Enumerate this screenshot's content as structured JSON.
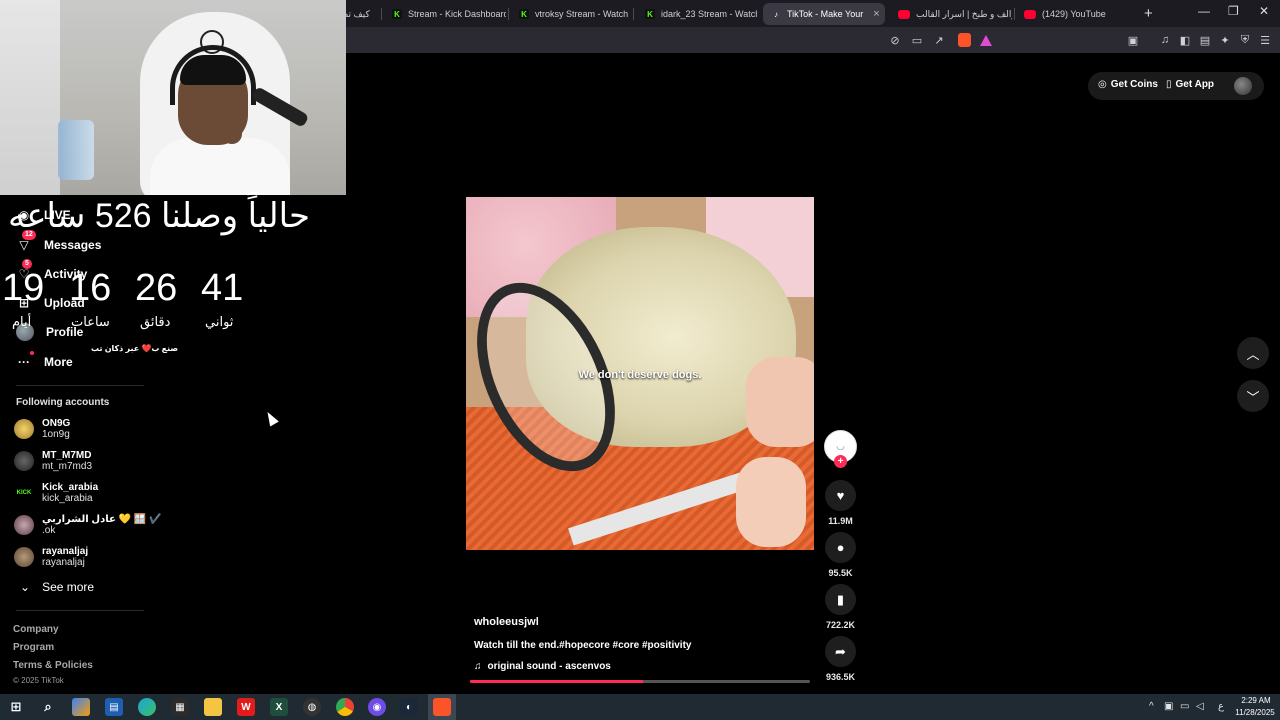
{
  "browser": {
    "tabs": [
      {
        "title": "كيف تصـ",
        "icon": "generic",
        "active": false
      },
      {
        "title": "Stream - Kick Dashboard",
        "icon": "kick-icon",
        "active": false
      },
      {
        "title": "vtroksy Stream - Watch Li",
        "icon": "kick-icon",
        "active": false
      },
      {
        "title": "idark_23 Stream - Watch L",
        "icon": "kick-icon",
        "active": false
      },
      {
        "title": "TikTok - Make Your",
        "icon": "tiktok-icon",
        "active": true
      },
      {
        "title": "سوالف و طبخ | اسرار القالب",
        "icon": "youtube-icon",
        "active": false
      },
      {
        "title": "(1429) YouTube",
        "icon": "youtube-icon",
        "active": false
      }
    ],
    "new_tab": "+",
    "window_controls": {
      "minimize": "—",
      "restore": "❐",
      "close": "✕"
    },
    "close_tab": "×"
  },
  "overlay": {
    "title": "حالياً وصلنا 526 ساعه",
    "countdown": [
      {
        "value": "19",
        "label": "أيام"
      },
      {
        "value": "16",
        "label": "ساعات"
      },
      {
        "value": "26",
        "label": "دقائق"
      },
      {
        "value": "41",
        "label": "ثواني"
      }
    ],
    "credit": "صنع ب❤️ عبر ذكان تب"
  },
  "sidebar": {
    "nav": [
      {
        "label": "LIVE",
        "icon": "live-icon",
        "badge": ""
      },
      {
        "label": "Messages",
        "icon": "messages-icon",
        "badge": "12"
      },
      {
        "label": "Activity",
        "icon": "activity-icon",
        "badge": "5"
      },
      {
        "label": "Upload",
        "icon": "upload-icon",
        "badge": ""
      },
      {
        "label": "Profile",
        "icon": "profile-avatar",
        "badge": ""
      },
      {
        "label": "More",
        "icon": "more-icon",
        "badge": ""
      }
    ],
    "following_title": "Following accounts",
    "accounts": [
      {
        "name": "ON9G",
        "handle": "1on9g"
      },
      {
        "name": "MT_M7MD",
        "handle": "mt_m7md3"
      },
      {
        "name": "Kick_arabia",
        "handle": "kick_arabia"
      },
      {
        "name": "عادل الشراربي 💛 🪟 ✔️",
        "handle": ".ok"
      },
      {
        "name": "rayanaljaj",
        "handle": "rayanaljaj"
      }
    ],
    "see_more": "See more",
    "footer": [
      "Company",
      "Program",
      "Terms & Policies"
    ],
    "copyright": "© 2025 TikTok"
  },
  "header": {
    "get_coins": "Get Coins",
    "get_app": "Get App"
  },
  "video": {
    "caption": "We don't deserve dogs.",
    "author": "wholeeusjwl",
    "description": "Watch till the end.#hopecore #core #positivity",
    "sound": "original sound - ascenvos",
    "progress": 0.51
  },
  "actions": {
    "likes": "11.9M",
    "comments": "95.5K",
    "saves": "722.2K",
    "shares": "936.5K",
    "follow": "+"
  },
  "taskbar": {
    "time": "2:29 AM",
    "date": "11/28/2025",
    "lang": "ع"
  },
  "colors": {
    "accent": "#fe2c55",
    "background": "#000000",
    "kick_green": "#53fc18"
  }
}
